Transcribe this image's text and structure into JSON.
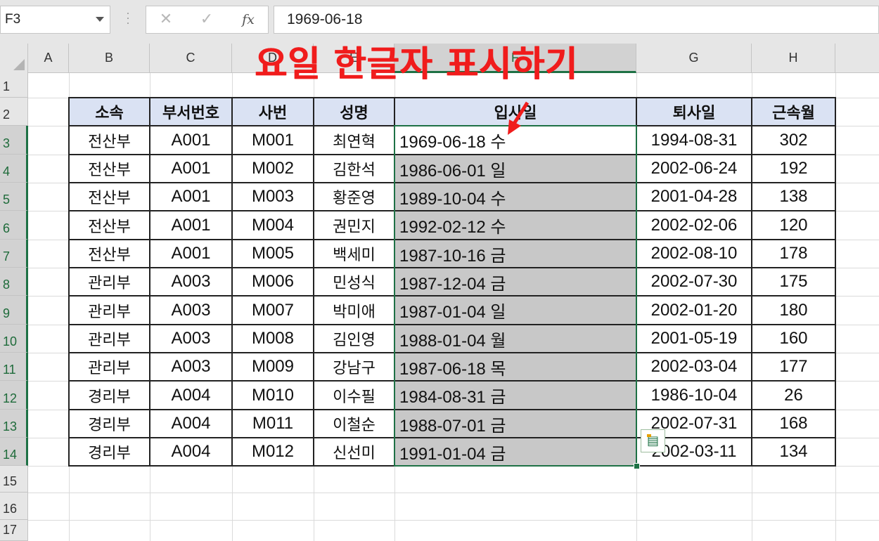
{
  "formula_bar": {
    "name_box": "F3",
    "cancel_icon": "✕",
    "enter_icon": "✓",
    "fx_label": "fx",
    "formula": "1969-06-18"
  },
  "overlay_title": "요일 한글자 표시하기",
  "columns": [
    "A",
    "B",
    "C",
    "D",
    "E",
    "F",
    "G",
    "H"
  ],
  "rows": [
    "1",
    "2",
    "3",
    "4",
    "5",
    "6",
    "7",
    "8",
    "9",
    "10",
    "11",
    "12",
    "13",
    "14",
    "15",
    "16",
    "17"
  ],
  "table": {
    "headers": [
      "소속",
      "부서번호",
      "사번",
      "성명",
      "입사일",
      "퇴사일",
      "근속월"
    ],
    "rows": [
      [
        "전산부",
        "A001",
        "M001",
        "최연혁",
        "1969-06-18 수",
        "1994-08-31",
        "302"
      ],
      [
        "전산부",
        "A001",
        "M002",
        "김한석",
        "1986-06-01 일",
        "2002-06-24",
        "192"
      ],
      [
        "전산부",
        "A001",
        "M003",
        "황준영",
        "1989-10-04 수",
        "2001-04-28",
        "138"
      ],
      [
        "전산부",
        "A001",
        "M004",
        "권민지",
        "1992-02-12 수",
        "2002-02-06",
        "120"
      ],
      [
        "전산부",
        "A001",
        "M005",
        "백세미",
        "1987-10-16 금",
        "2002-08-10",
        "178"
      ],
      [
        "관리부",
        "A003",
        "M006",
        "민성식",
        "1987-12-04 금",
        "2002-07-30",
        "175"
      ],
      [
        "관리부",
        "A003",
        "M007",
        "박미애",
        "1987-01-04 일",
        "2002-01-20",
        "180"
      ],
      [
        "관리부",
        "A003",
        "M008",
        "김인영",
        "1988-01-04 월",
        "2001-05-19",
        "160"
      ],
      [
        "관리부",
        "A003",
        "M009",
        "강남구",
        "1987-06-18 목",
        "2002-03-04",
        "177"
      ],
      [
        "경리부",
        "A004",
        "M010",
        "이수필",
        "1984-08-31 금",
        "1986-10-04",
        "26"
      ],
      [
        "경리부",
        "A004",
        "M011",
        "이철순",
        "1988-07-01 금",
        "2002-07-31",
        "168"
      ],
      [
        "경리부",
        "A004",
        "M012",
        "신선미",
        "1991-01-04 금",
        "2002-03-11",
        "134"
      ]
    ]
  },
  "colors": {
    "header_fill": "#dae2f3",
    "selection_fill": "#c8c8c8",
    "selection_border": "#1e7145",
    "annotation_red": "#f01c1c"
  },
  "icons": {
    "quick_analysis": "quick-analysis-icon"
  }
}
